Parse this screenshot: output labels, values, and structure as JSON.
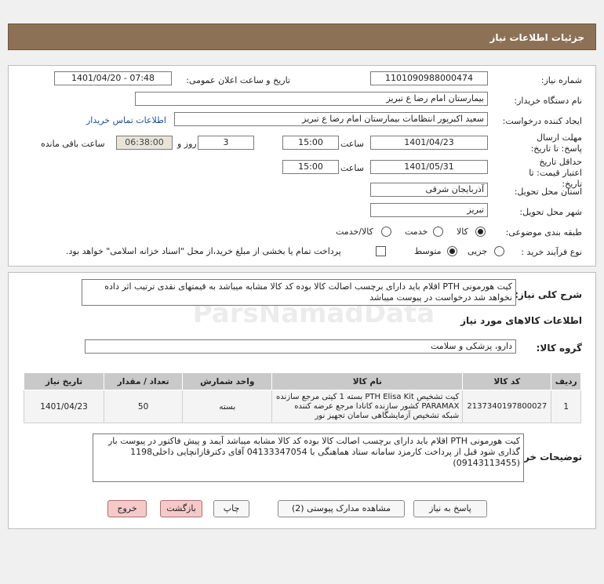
{
  "header": {
    "title": "جزئیات اطلاعات نیاز"
  },
  "form": {
    "need_number_label": "شماره نیاز:",
    "need_number": "1101090988000474",
    "announce_label": "تاریخ و ساعت اعلان عمومی:",
    "announce_value": "1401/04/20 - 07:48",
    "buyer_org_label": "نام دستگاه خریدار:",
    "buyer_org": "بیمارستان امام رضا  ع  تبریز",
    "requester_label": "ایجاد کننده درخواست:",
    "requester": "سعید اکبرپور انتظامات بیمارستان امام رضا  ع  تبریز",
    "contact_link": "اطلاعات تماس خریدار",
    "reply_deadline_label": "مهلت ارسال پاسخ: تا تاریخ:",
    "reply_date": "1401/04/23",
    "time_label": "ساعت",
    "reply_time": "15:00",
    "days": "3",
    "days_label": "روز و",
    "remaining_time": "06:38:00",
    "remaining_label": "ساعت باقی مانده",
    "price_validity_label": "حداقل تاریخ اعتبار قیمت: تا تاریخ:",
    "price_date": "1401/05/31",
    "price_time": "15:00",
    "province_label": "استان محل تحویل:",
    "province": "آذربایجان شرقی",
    "city_label": "شهر محل تحویل:",
    "city": "تبریز",
    "category_label": "طبقه بندی موضوعی:",
    "category_options": [
      "کالا",
      "خدمت",
      "کالا/خدمت"
    ],
    "category_selected": "کالا",
    "process_label": "نوع فرآیند خرید :",
    "process_options": [
      "جزیی",
      "متوسط"
    ],
    "process_selected": "متوسط",
    "payment_note": "پرداخت تمام یا بخشی از مبلغ خرید،از محل \"اسناد خزانه اسلامی\" خواهد بود."
  },
  "description": {
    "label": "شرح کلی نیاز:",
    "text": "کیت هورمونی PTH اقلام باید دارای برچسب اصالت کالا بوده کد کالا مشابه میباشد به قیمتهای نقدی ترتیب اثر داده نخواهد شد درخواست در پیوست میباشد"
  },
  "goods": {
    "section_title": "اطلاعات کالاهای مورد نیاز",
    "group_label": "گروه کالا:",
    "group_value": "دارو، پزشکی و سلامت",
    "columns": [
      "ردیف",
      "کد کالا",
      "نام کالا",
      "واحد شمارش",
      "تعداد / مقدار",
      "تاریخ نیاز"
    ],
    "rows": [
      {
        "row": "1",
        "code": "2137340197800027",
        "name": "کیت تشخیص PTH Elisa Kit بسته 1 کیتی مرجع سازنده PARAMAX کشور سازنده کانادا مرجع عرضه کننده شبکه تشخیص آزمایشگاهی سامان تجهیز نور",
        "unit": "بسته",
        "qty": "50",
        "date": "1401/04/23"
      }
    ]
  },
  "buyer_notes": {
    "label": "توضیحات خریدار:",
    "text": "کیت هورمونی PTH اقلام باید دارای برچسب اصالت کالا بوده کد کالا مشابه میباشد آیمد و پیش فاکتور در پیوست بار گذاری شود قبل از پرداخت کارمزد سامانه ستاد هماهنگی با 04133347054  آقای دکترقازانچایی داخلی1198 (09143113455)"
  },
  "buttons": {
    "reply": "پاسخ به نیاز",
    "attachments": "مشاهده مدارک پیوستی (2)",
    "print": "چاپ",
    "back": "بازگشت",
    "exit": "خروج"
  },
  "watermark": "ParsNamadData"
}
